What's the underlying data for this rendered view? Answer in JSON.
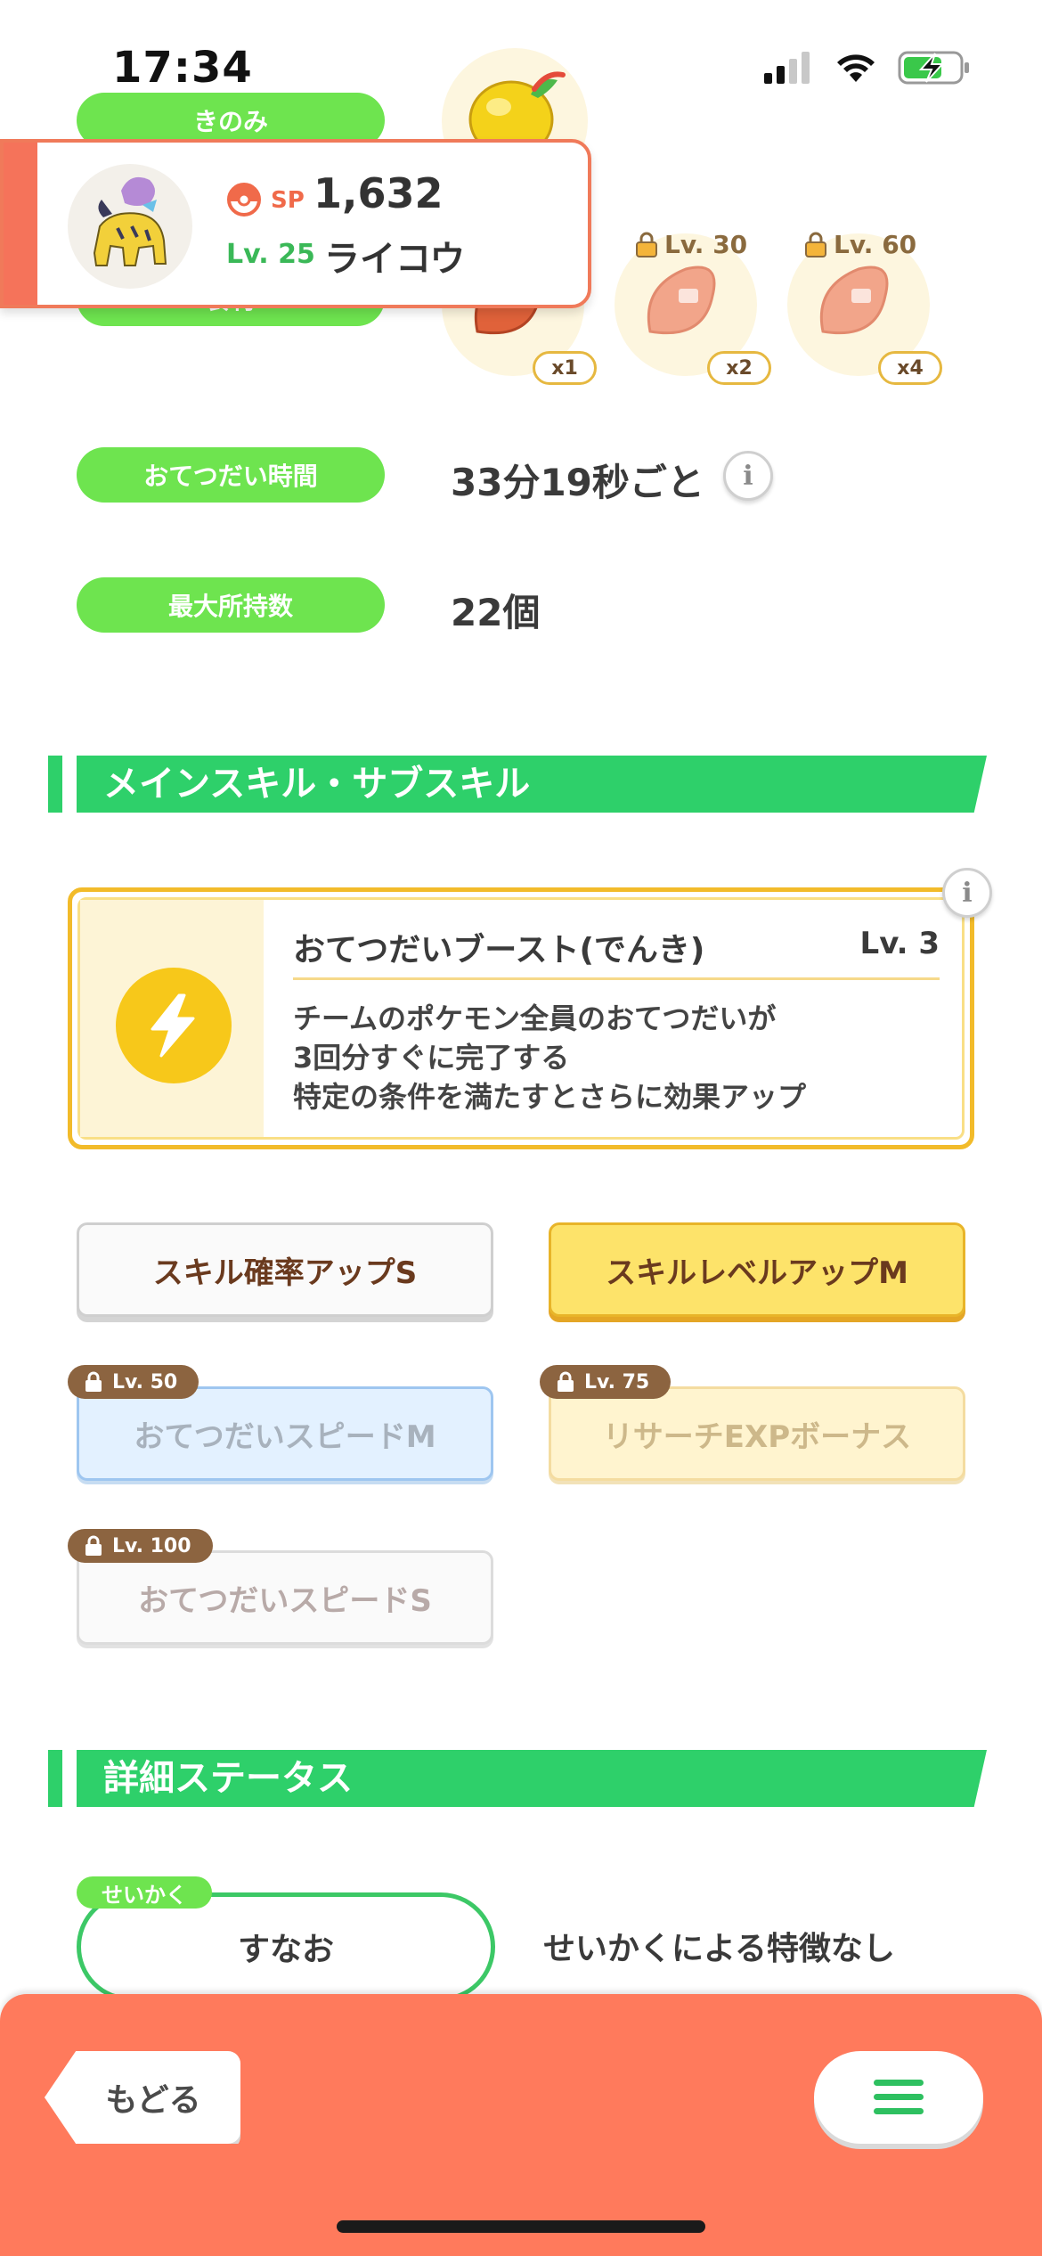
{
  "status_bar": {
    "time": "17:34"
  },
  "labels": {
    "berry": "きのみ",
    "ingredient": "食材",
    "help_time": "おてつだい時間",
    "max_carry": "最大所持数"
  },
  "help_time_value": "33分19秒ごと",
  "max_carry_value": "22個",
  "ingredients": [
    {
      "lock_label": "",
      "qty": "x1"
    },
    {
      "lock_label": "Lv. 30",
      "qty": "x2"
    },
    {
      "lock_label": "Lv. 60",
      "qty": "x4"
    }
  ],
  "pokemon": {
    "sp_label": "SP",
    "sp_value": "1,632",
    "level": "Lv. 25",
    "name": "ライコウ"
  },
  "sections": {
    "skills": "メインスキル・サブスキル",
    "details": "詳細ステータス"
  },
  "main_skill": {
    "name": "おてつだいブースト(でんき)",
    "level": "Lv. 3",
    "desc_line1": "チームのポケモン全員のおてつだいが",
    "desc_line2": "3回分すぐに完了する",
    "desc_line3": "特定の条件を満たすとさらに効果アップ"
  },
  "sub_skills": [
    {
      "label": "スキル確率アップS",
      "lock": ""
    },
    {
      "label": "スキルレベルアップM",
      "lock": ""
    },
    {
      "label": "おてつだいスピードM",
      "lock": "Lv. 50"
    },
    {
      "label": "リサーチEXPボーナス",
      "lock": "Lv. 75"
    },
    {
      "label": "おてつだいスピードS",
      "lock": "Lv. 100"
    }
  ],
  "nature": {
    "tag": "せいかく",
    "value": "すなお",
    "desc": "せいかくによる特徴なし"
  },
  "bottom": {
    "back_label": "もどる"
  },
  "colors": {
    "green": "#6ee44f",
    "section_green": "#2ed06a",
    "coral": "#ff7a5c",
    "gold": "#f2bb2a"
  }
}
